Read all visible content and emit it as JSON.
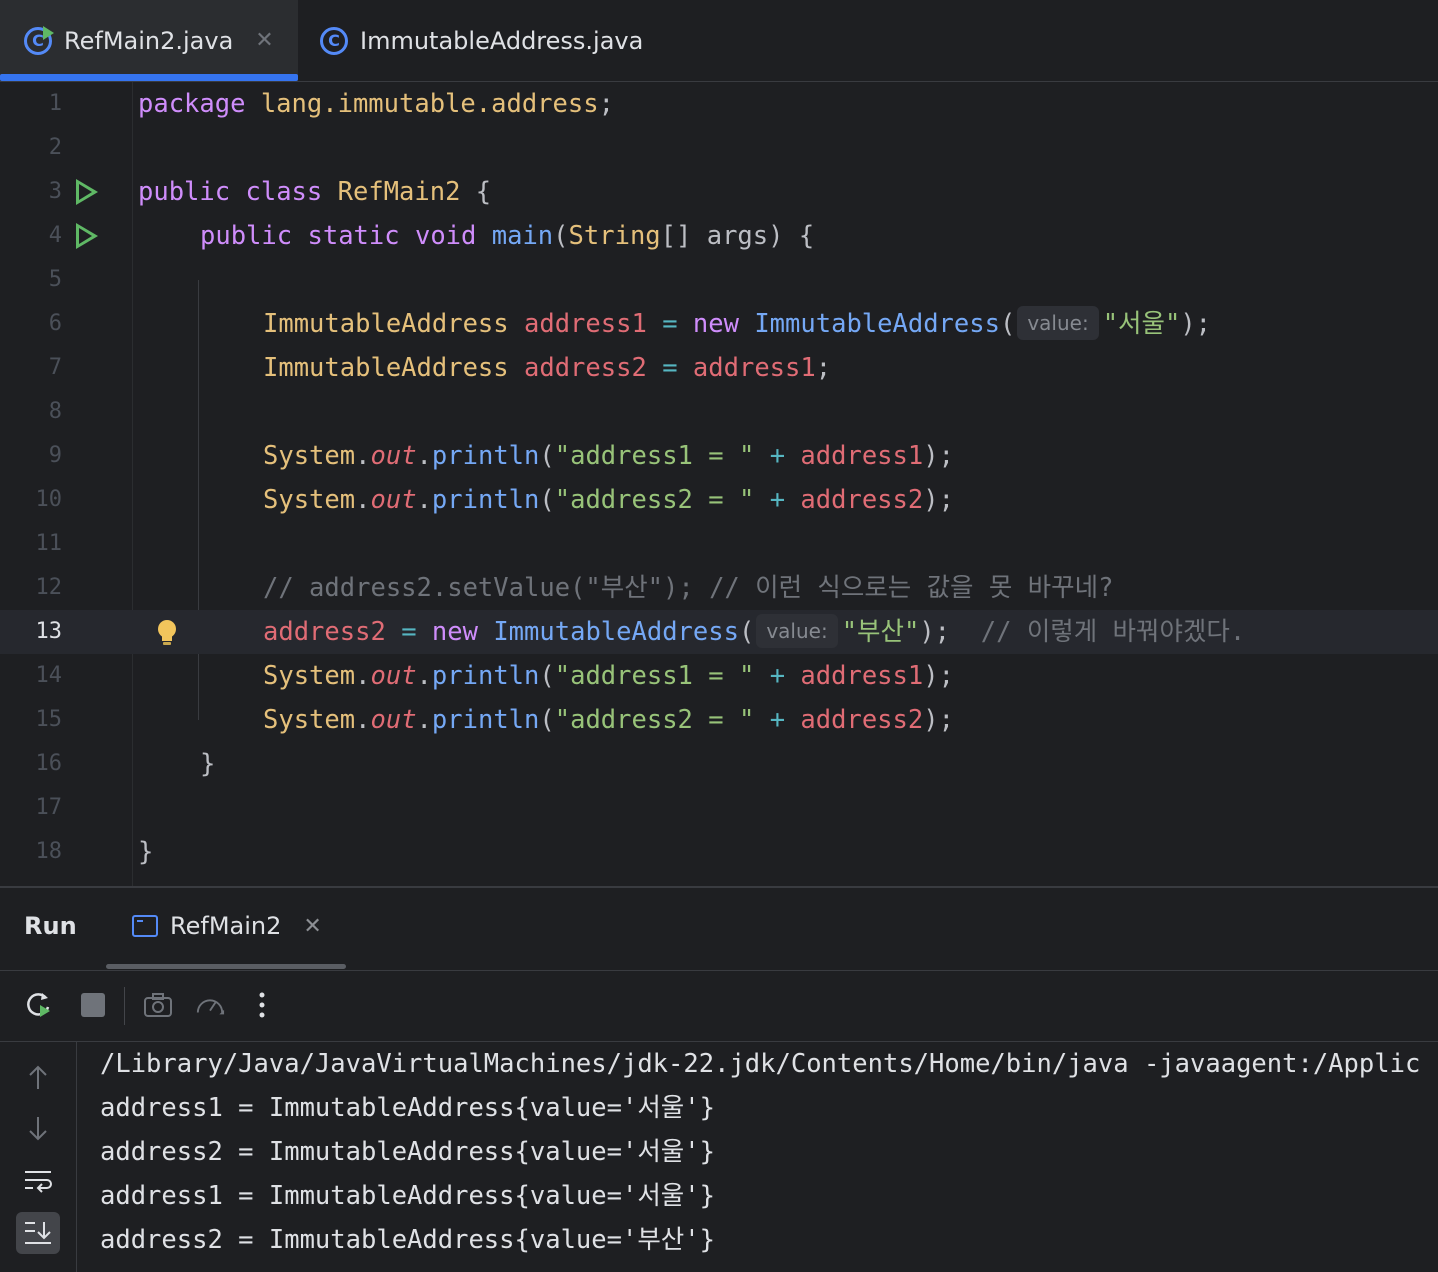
{
  "tabs": [
    {
      "label": "RefMain2.java",
      "active": true
    },
    {
      "label": "ImmutableAddress.java",
      "active": false
    }
  ],
  "editor": {
    "line_numbers": [
      "1",
      "2",
      "3",
      "4",
      "5",
      "6",
      "7",
      "8",
      "9",
      "10",
      "11",
      "12",
      "13",
      "14",
      "15",
      "16",
      "17",
      "18"
    ],
    "current_line": "13",
    "tokens": {
      "l1_kw": "package",
      "l1_pkg": "lang.immutable.address",
      "semi": ";",
      "l3_kw1": "public",
      "l3_kw2": "class",
      "l3_cls": "RefMain2",
      "brace_open": "{",
      "brace_close": "}",
      "l4_kw1": "public",
      "l4_kw2": "static",
      "l4_kw3": "void",
      "l4_fn": "main",
      "l4_params_open": "(",
      "l4_type": "String",
      "l4_rest": "[] args) ",
      "type_name": "ImmutableAddress",
      "var1": "address1",
      "var2": "address2",
      "eq": "=",
      "new_kw": "new",
      "ctor": "ImmutableAddress",
      "paren_open": "(",
      "paren_close_semi": ");",
      "hint_label": "value:",
      "str_seoul": "\"서울\"",
      "str_busan": "\"부산\"",
      "system": "System",
      "dot": ".",
      "out": "out",
      "println": "println",
      "str_a1": "\"address1 = \"",
      "str_a2": "\"address2 = \"",
      "plus": "+",
      "comment12": "// address2.setValue(\"부산\"); // 이런 식으로는 값을 못 바꾸네?",
      "comment13": "// 이렇게 바꿔야겠다."
    }
  },
  "run_panel": {
    "title": "Run",
    "tab_label": "RefMain2",
    "console_lines": [
      "/Library/Java/JavaVirtualMachines/jdk-22.jdk/Contents/Home/bin/java -javaagent:/Applic",
      "address1 = ImmutableAddress{value='서울'}",
      "address2 = ImmutableAddress{value='서울'}",
      "address1 = ImmutableAddress{value='서울'}",
      "address2 = ImmutableAddress{value='부산'}"
    ]
  },
  "icons": {
    "tab_file_icon": "java-class-icon",
    "run_gutter_icon": "run-icon",
    "bulb_icon": "lightbulb-icon",
    "close_icon": "close-icon"
  },
  "tab_close_glyph": "✕",
  "colors": {
    "keyword": "#cf8dfb",
    "type": "#e5c07b",
    "function": "#75a8f5",
    "variable": "#e06c75",
    "string": "#98c379",
    "comment": "#6f737a",
    "accent": "#3574f0"
  }
}
